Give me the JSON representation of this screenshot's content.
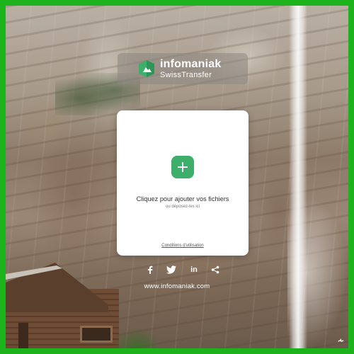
{
  "brand": {
    "name": "infomaniak",
    "product": "SwissTransfer",
    "logo_icon": "swisstransfer-logo-icon",
    "logo_color": "#3daf6a"
  },
  "upload_card": {
    "add_icon": "plus-icon",
    "title": "Cliquez pour ajouter vos fichiers",
    "subtitle": "ou déposez-les ici",
    "terms_link": "Conditions d'utilisation",
    "accent_color": "#3daf6a"
  },
  "social": {
    "icons": [
      "facebook-icon",
      "twitter-icon",
      "linkedin-icon",
      "share-icon"
    ]
  },
  "footer": {
    "website": "www.infomaniak.com"
  },
  "frame_color": "#1db31d"
}
